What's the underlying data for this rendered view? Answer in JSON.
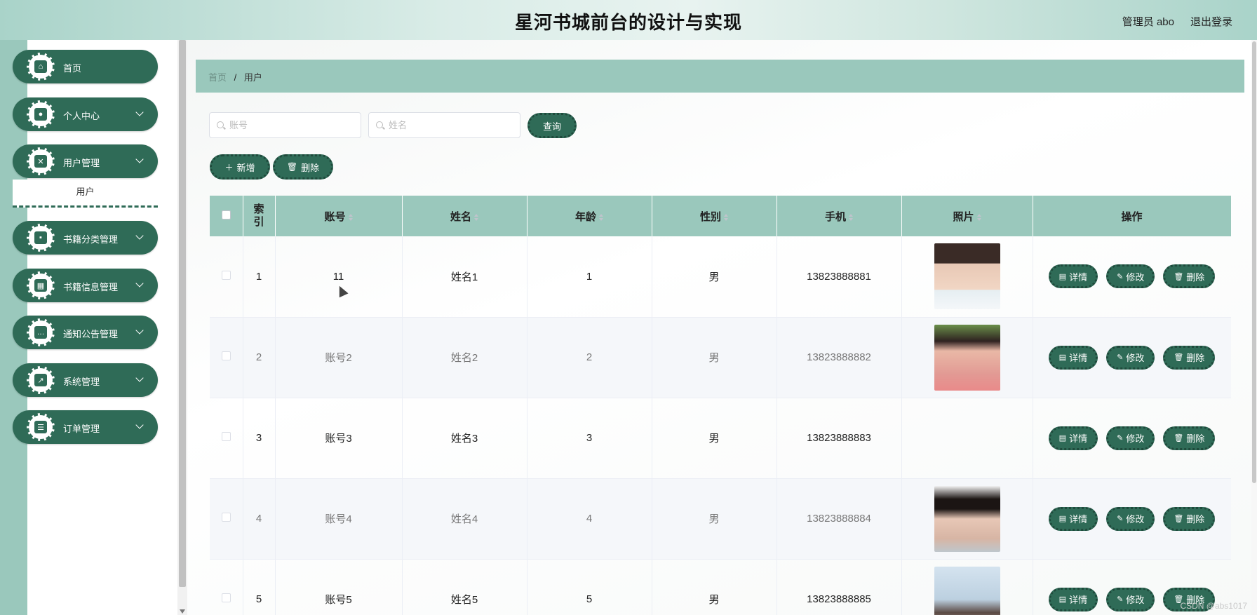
{
  "header": {
    "title": "星河书城前台的设计与实现",
    "user": "管理员 abo",
    "logout": "退出登录"
  },
  "sidebar": {
    "items": [
      {
        "label": "首页",
        "icon": "home-icon"
      },
      {
        "label": "个人中心",
        "icon": "person-icon"
      },
      {
        "label": "用户管理",
        "icon": "clipboard-icon"
      },
      {
        "label": "书籍分类管理",
        "icon": "wallet-icon"
      },
      {
        "label": "书籍信息管理",
        "icon": "grid-icon"
      },
      {
        "label": "通知公告管理",
        "icon": "chat-icon"
      },
      {
        "label": "系统管理",
        "icon": "chart-icon"
      },
      {
        "label": "订单管理",
        "icon": "list-icon"
      }
    ],
    "submenu_user": "用户"
  },
  "breadcrumb": {
    "home": "首页",
    "separator": "/",
    "current": "用户"
  },
  "search": {
    "account_placeholder": "账号",
    "name_placeholder": "姓名",
    "query_button": "查询"
  },
  "toolbar": {
    "add_button": "新增",
    "delete_button": "删除"
  },
  "table": {
    "headers": {
      "index": "索引",
      "account": "账号",
      "name": "姓名",
      "age": "年龄",
      "gender": "性别",
      "phone": "手机",
      "photo": "照片",
      "actions": "操作"
    },
    "rows": [
      {
        "index": "1",
        "account": "11",
        "name": "姓名1",
        "age": "1",
        "gender": "男",
        "phone": "13823888881"
      },
      {
        "index": "2",
        "account": "账号2",
        "name": "姓名2",
        "age": "2",
        "gender": "男",
        "phone": "13823888882"
      },
      {
        "index": "3",
        "account": "账号3",
        "name": "姓名3",
        "age": "3",
        "gender": "男",
        "phone": "13823888883"
      },
      {
        "index": "4",
        "account": "账号4",
        "name": "姓名4",
        "age": "4",
        "gender": "男",
        "phone": "13823888884"
      },
      {
        "index": "5",
        "account": "账号5",
        "name": "姓名5",
        "age": "5",
        "gender": "男",
        "phone": "13823888885"
      }
    ],
    "action_labels": {
      "detail": "详情",
      "edit": "修改",
      "delete": "删除"
    }
  },
  "watermark": "CSDN @abs1017",
  "colors": {
    "primary": "#2f6b57",
    "accent": "#9ac8bc"
  }
}
